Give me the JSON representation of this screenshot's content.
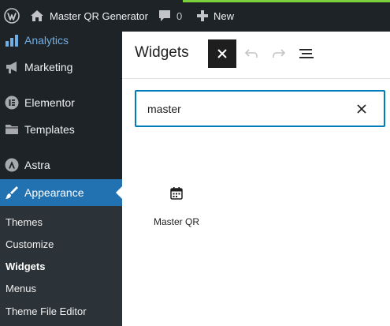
{
  "admin_bar": {
    "wp_logo_icon": "wordpress-logo-icon",
    "site_name": "Master QR Generator",
    "comments_count": "0",
    "new_label": "New",
    "accent_color": "#7ad03a"
  },
  "sidebar": {
    "items": [
      {
        "label": "Analytics",
        "icon": "analytics-icon",
        "color": "#72aee6"
      },
      {
        "label": "Marketing",
        "icon": "megaphone-icon"
      },
      {
        "label": "Elementor",
        "icon": "elementor-icon"
      },
      {
        "label": "Templates",
        "icon": "folder-icon"
      },
      {
        "label": "Astra",
        "icon": "astra-icon"
      },
      {
        "label": "Appearance",
        "icon": "paintbrush-icon",
        "active": true,
        "color": "#2271b1"
      }
    ],
    "submenu": [
      {
        "label": "Themes"
      },
      {
        "label": "Customize"
      },
      {
        "label": "Widgets",
        "current": true
      },
      {
        "label": "Menus"
      },
      {
        "label": "Theme File Editor"
      }
    ]
  },
  "editor": {
    "title": "Widgets",
    "toolbar_icons": [
      "close-icon",
      "undo-icon",
      "redo-icon",
      "list-view-icon"
    ],
    "search": {
      "value": "master",
      "border_color": "#007cba"
    },
    "results": [
      {
        "label": "Master QR",
        "icon": "calendar-icon"
      }
    ]
  }
}
